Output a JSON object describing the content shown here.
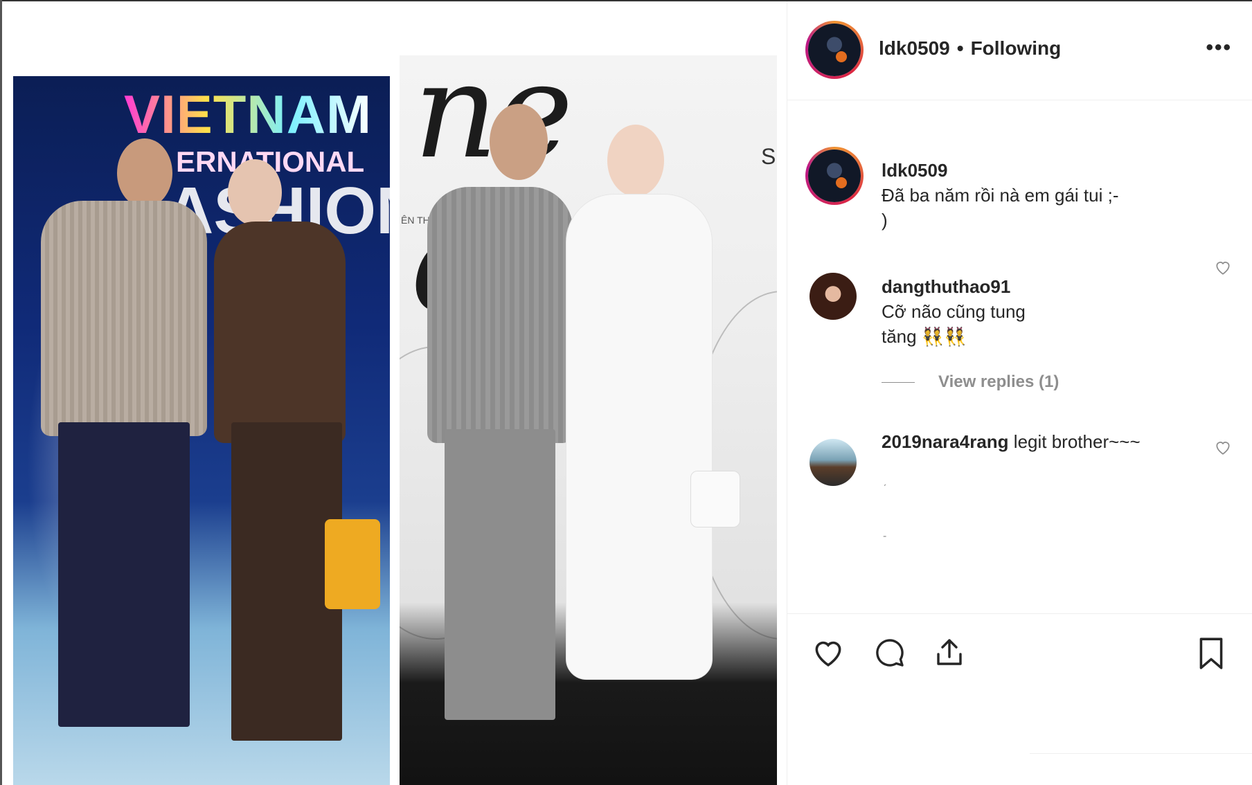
{
  "post": {
    "username": "ldk0509",
    "separator": "•",
    "follow_status": "Following",
    "more_glyph": "•••"
  },
  "media": {
    "photo1": {
      "title": "VIETNAM",
      "subtitle": "ERNATIONAL",
      "big_text": "ASHION"
    },
    "photo2": {
      "script_text": "ne day",
      "small_text": "ÊN THÔN",
      "side_letter": "S"
    }
  },
  "comments": [
    {
      "username": "ldk0509",
      "text": "Đã ba năm rồi nà em gái tui ;-\n)",
      "is_caption": true
    },
    {
      "username": "dangthuthao91",
      "text": "Cỡ não cũng tung\ntăng 👯👯",
      "is_caption": false
    },
    {
      "username": "2019nara4rang",
      "text": "legit brother~~~",
      "is_caption": false
    }
  ],
  "view_replies": "View replies (1)",
  "colors": {
    "text": "#262626",
    "muted": "#8e8e8e",
    "border": "#efefef"
  }
}
